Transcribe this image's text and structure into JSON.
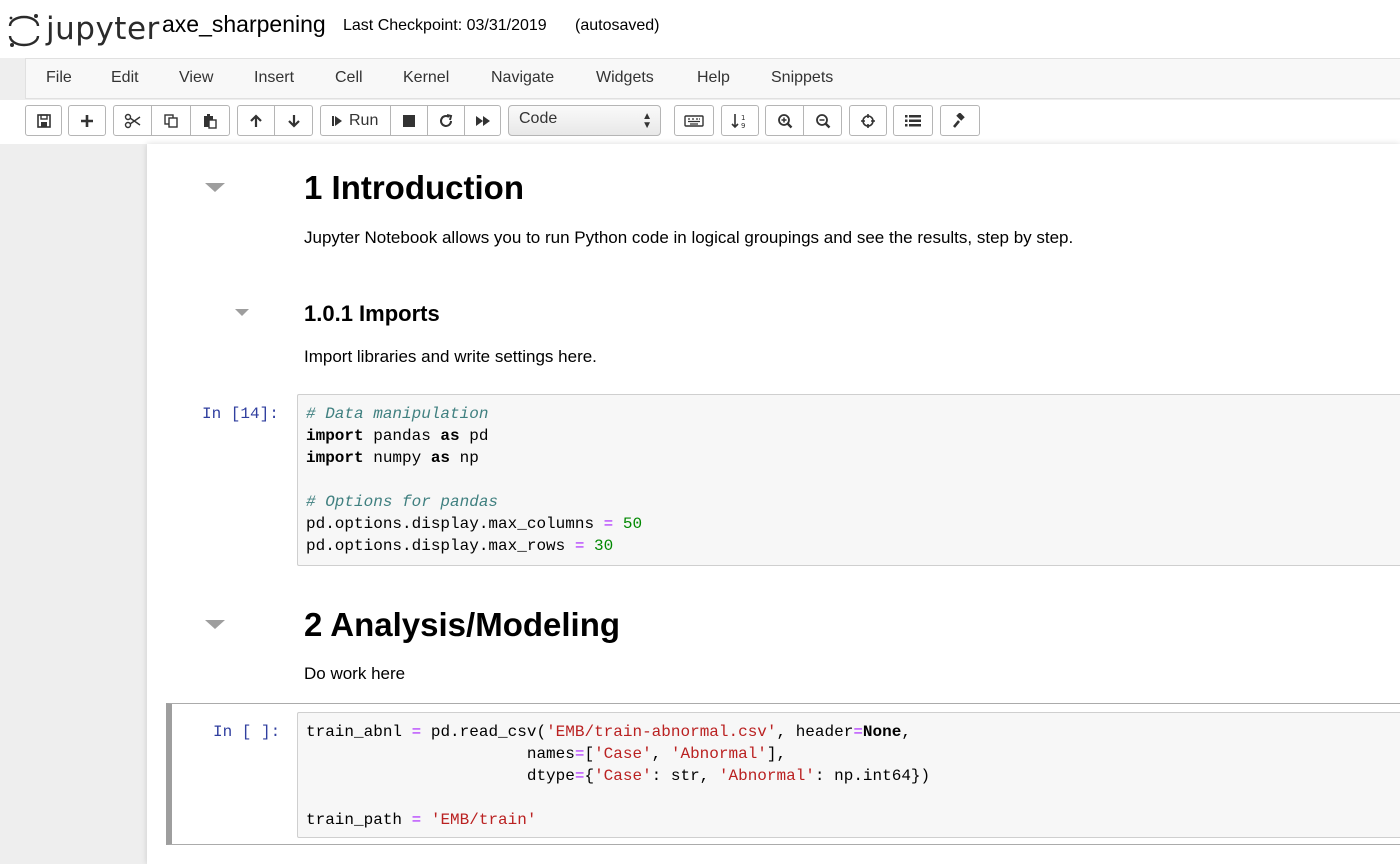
{
  "header": {
    "logo_text": "jupyter",
    "notebook_name": "axe_sharpening",
    "checkpoint": "Last Checkpoint: 03/31/2019",
    "autosave_status": "(autosaved)"
  },
  "menu": {
    "items": [
      "File",
      "Edit",
      "View",
      "Insert",
      "Cell",
      "Kernel",
      "Navigate",
      "Widgets",
      "Help",
      "Snippets"
    ]
  },
  "toolbar": {
    "run_label": "Run",
    "cell_type": "Code"
  },
  "cells": {
    "h1_intro": "1  Introduction",
    "intro_text": "Jupyter Notebook allows you to run Python code in logical groupings and see the results, step by step.",
    "h3_imports": "1.0.1  Imports",
    "imports_text": "Import libraries and write settings here.",
    "prompt_1": "In [14]:",
    "h1_analysis": "2  Analysis/Modeling",
    "analysis_text": "Do work here",
    "prompt_2": "In [ ]:"
  },
  "code1": {
    "l1": "# Data manipulation",
    "l2_kw": "import",
    "l2_mod": " pandas ",
    "l2_as": "as",
    "l2_alias": " pd",
    "l3_kw": "import",
    "l3_mod": " numpy ",
    "l3_as": "as",
    "l3_alias": " np",
    "l4": "# Options for pandas",
    "l5_a": "pd.options.display.max_columns ",
    "l5_op": "=",
    "l5_num": " 50",
    "l6_a": "pd.options.display.max_rows ",
    "l6_op": "=",
    "l6_num": " 30"
  },
  "code2": {
    "l1_a": "train_abnl ",
    "l1_op": "=",
    "l1_b": " pd.read_csv(",
    "l1_str": "'EMB/train-abnormal.csv'",
    "l1_c": ", header",
    "l1_op2": "=",
    "l1_kw": "None",
    "l1_d": ",",
    "l2_a": "                       names",
    "l2_op": "=",
    "l2_b": "[",
    "l2_s1": "'Case'",
    "l2_c": ", ",
    "l2_s2": "'Abnormal'",
    "l2_d": "],",
    "l3_a": "                       dtype",
    "l3_op": "=",
    "l3_b": "{",
    "l3_s1": "'Case'",
    "l3_c": ": str, ",
    "l3_s2": "'Abnormal'",
    "l3_d": ": np.int64})",
    "l5_a": "train_path ",
    "l5_op": "=",
    "l5_sp": " ",
    "l5_str": "'EMB/train'"
  }
}
